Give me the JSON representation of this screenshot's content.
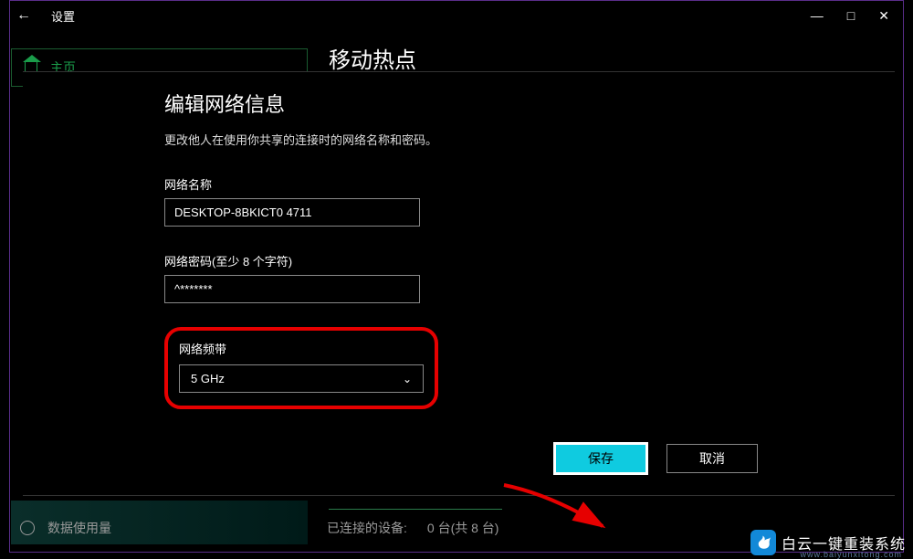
{
  "titlebar": {
    "title": "设置"
  },
  "sidebar": {
    "home": "主页",
    "usage": "数据使用量"
  },
  "page": {
    "title": "移动热点"
  },
  "dialog": {
    "title": "编辑网络信息",
    "desc": "更改他人在使用你共享的连接时的网络名称和密码。",
    "name_label": "网络名称",
    "name_value": "DESKTOP-8BKICT0 4711",
    "pwd_label": "网络密码(至少 8 个字符)",
    "pwd_value": "^*******",
    "band_label": "网络频带",
    "band_value": "5 GHz",
    "save": "保存",
    "cancel": "取消"
  },
  "bottom": {
    "devices_label": "已连接的设备:",
    "devices_value": "0 台(共 8 台)"
  },
  "watermark": {
    "text": "白云一键重装系统",
    "url": "www.baiyunxitong.com"
  }
}
